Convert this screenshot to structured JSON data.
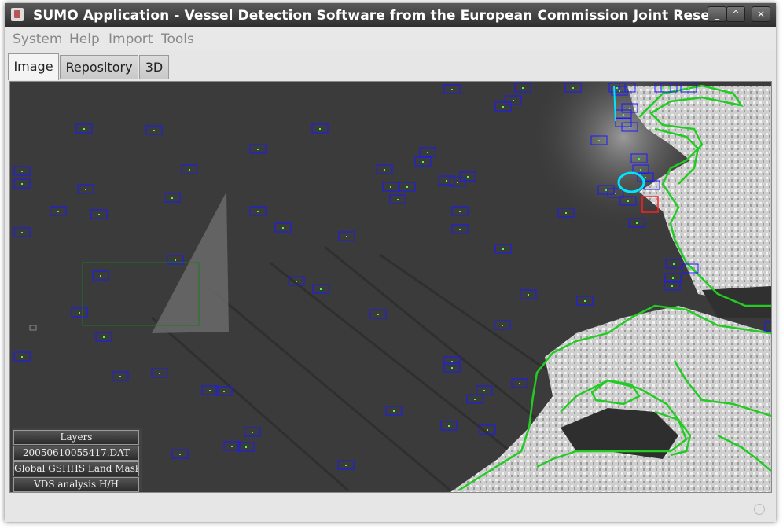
{
  "window": {
    "title": "SUMO Application - Vessel Detection Software from the European Commission Joint Research",
    "controls": {
      "minimize": "_",
      "maximize": "^",
      "close": "✕"
    }
  },
  "menu": [
    "System",
    "Help",
    "Import",
    "Tools"
  ],
  "tabs": [
    {
      "label": "Image",
      "active": true
    },
    {
      "label": "Repository",
      "active": false
    },
    {
      "label": "3D",
      "active": false
    }
  ],
  "layers": {
    "title": "Layers",
    "items": [
      "20050610055417.DAT",
      "Global GSHHS Land Mask",
      "VDS analysis H/H"
    ]
  },
  "colors": {
    "detection_box": "#1a1aff",
    "land_mask": "#22cc22",
    "selected_box": "#ff2020",
    "ship_glow": "#00ffff",
    "sea": "#3a3a3a",
    "land": "#d8d8d8"
  }
}
